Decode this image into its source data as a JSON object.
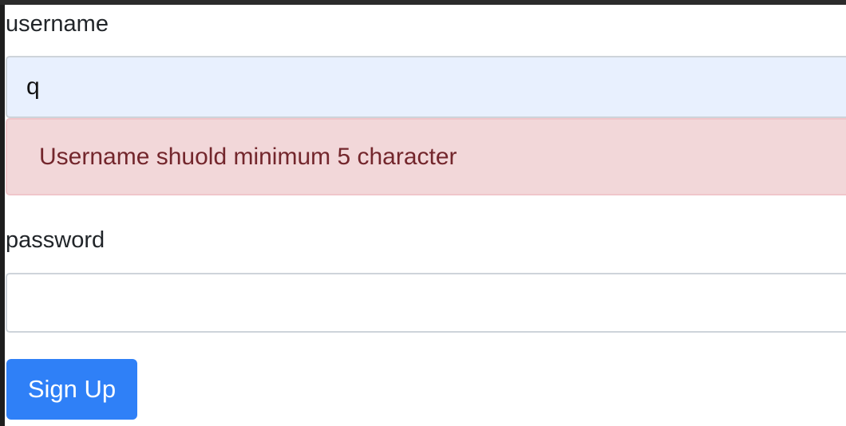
{
  "form": {
    "username_label": "username",
    "username_value": "q",
    "username_error": "Username shuold minimum 5 character",
    "password_label": "password",
    "password_value": "",
    "submit_label": "Sign Up"
  },
  "colors": {
    "autofill_background": "#e8f0fe",
    "error_background": "#f2d7d9",
    "error_text": "#73262c",
    "primary_button": "#2f80f7"
  }
}
